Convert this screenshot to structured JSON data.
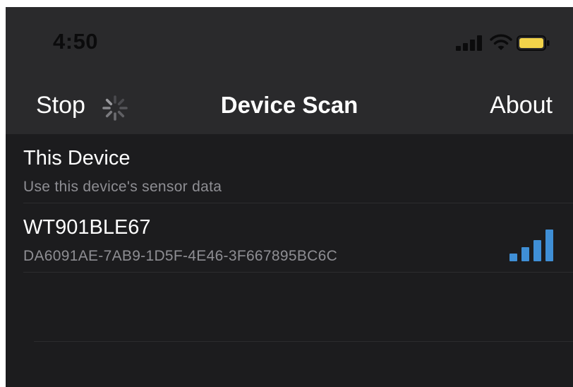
{
  "status_bar": {
    "time": "4:50",
    "icons": [
      "cellular-signal-icon",
      "wifi-icon",
      "battery-icon"
    ],
    "battery_color": "#f2d34a"
  },
  "nav": {
    "left_button": "Stop",
    "title": "Device Scan",
    "right_button": "About",
    "activity_indicator": "spinner-icon"
  },
  "devices": [
    {
      "name": "This Device",
      "detail": "Use this device's sensor data"
    },
    {
      "name": "WT901BLE67",
      "detail": "DA6091AE-7AB9-1D5F-4E46-3F667895BC6C",
      "signal_icon": "signal-strength-icon",
      "signal_bars": 4,
      "signal_max": 4,
      "signal_color": "#3f8fd6"
    }
  ],
  "colors": {
    "background": "#1c1c1e",
    "bar_background": "#2a2a2c",
    "primary_text": "#ffffff",
    "secondary_text": "#8e8e93"
  }
}
